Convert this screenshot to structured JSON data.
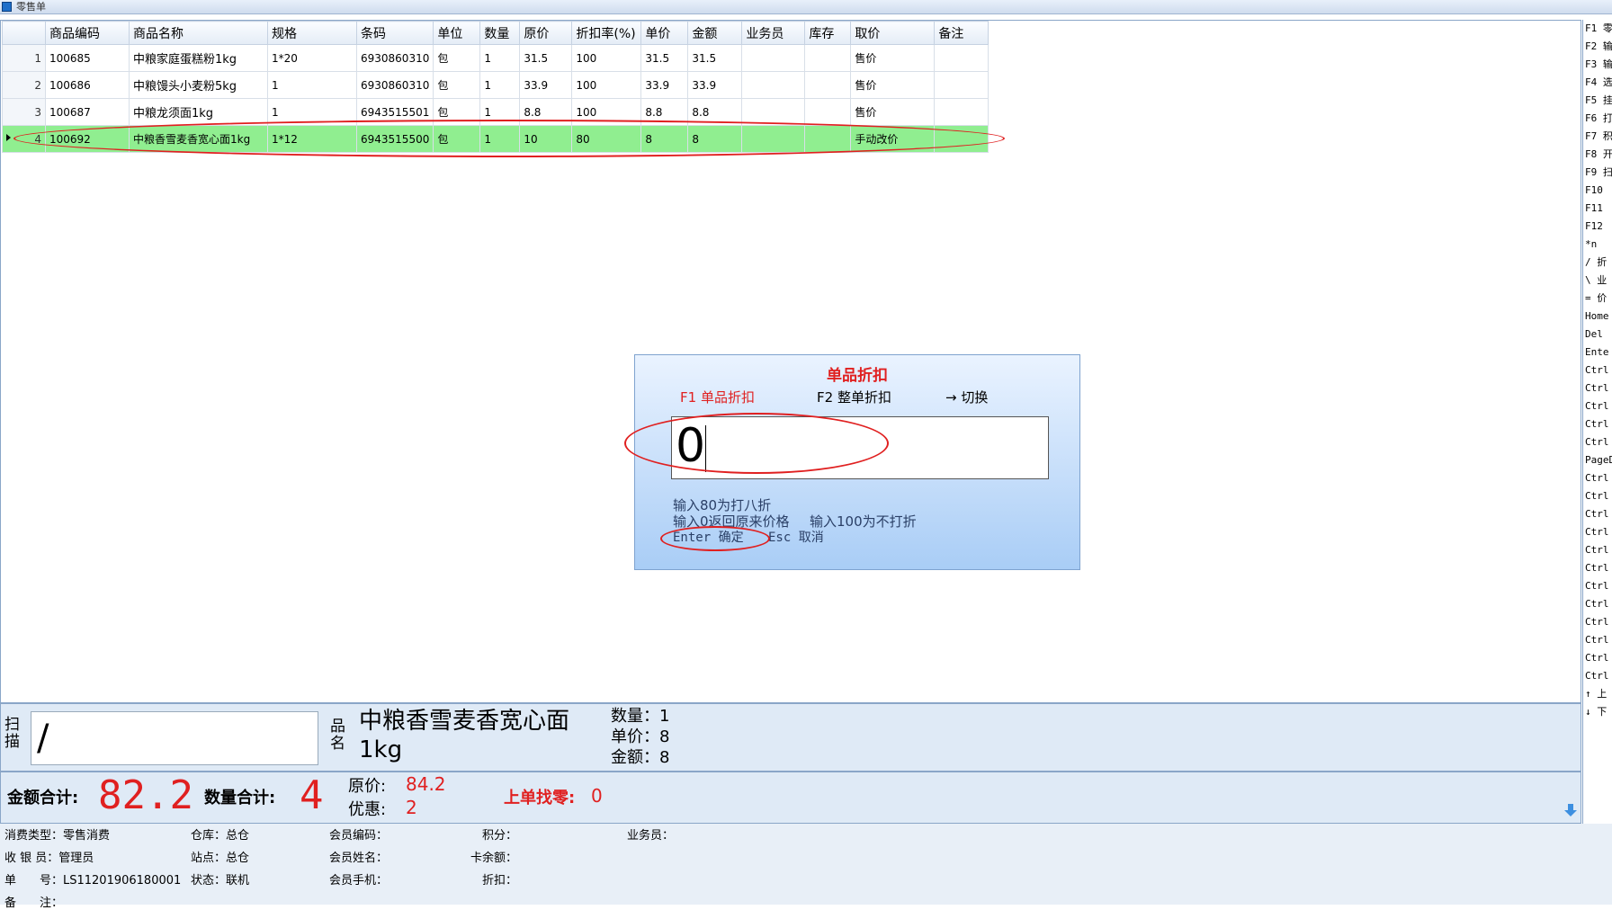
{
  "window": {
    "title": "零售单"
  },
  "grid": {
    "columns": [
      "商品编码",
      "商品名称",
      "规格",
      "条码",
      "单位",
      "数量",
      "原价",
      "折扣率(%)",
      "单价",
      "金额",
      "业务员",
      "库存",
      "取价",
      "备注"
    ],
    "rows": [
      {
        "idx": "1",
        "code": "100685",
        "name": "中粮家庭蛋糕粉1kg",
        "spec": "1*20",
        "barcode": "6930860310",
        "unit": "包",
        "qty": "1",
        "orig": "31.5",
        "rate": "100",
        "price": "31.5",
        "amount": "31.5",
        "sales": "",
        "stock": "",
        "pricing": "售价",
        "note": ""
      },
      {
        "idx": "2",
        "code": "100686",
        "name": "中粮馒头小麦粉5kg",
        "spec": "1",
        "barcode": "6930860310",
        "unit": "包",
        "qty": "1",
        "orig": "33.9",
        "rate": "100",
        "price": "33.9",
        "amount": "33.9",
        "sales": "",
        "stock": "",
        "pricing": "售价",
        "note": ""
      },
      {
        "idx": "3",
        "code": "100687",
        "name": "中粮龙须面1kg",
        "spec": "1",
        "barcode": "6943515501",
        "unit": "包",
        "qty": "1",
        "orig": "8.8",
        "rate": "100",
        "price": "8.8",
        "amount": "8.8",
        "sales": "",
        "stock": "",
        "pricing": "售价",
        "note": ""
      },
      {
        "idx": "4",
        "code": "100692",
        "name": "中粮香雪麦香宽心面1kg",
        "spec": "1*12",
        "barcode": "6943515500",
        "unit": "包",
        "qty": "1",
        "orig": "10",
        "rate": "80",
        "price": "8",
        "amount": "8",
        "sales": "",
        "stock": "",
        "pricing": "手动改价",
        "note": ""
      }
    ]
  },
  "dialog": {
    "title": "单品折扣",
    "tab1": "F1 单品折扣",
    "tab2": "F2 整单折扣",
    "switch": "→ 切换",
    "input_value": "0",
    "hint1": "输入80为打八折",
    "hint2": "输入0返回原来价格",
    "hint3": "输入100为不打折",
    "enter": "Enter 确定",
    "esc": "Esc 取消"
  },
  "scan": {
    "label": "扫描",
    "value": "/",
    "name_label": "品名",
    "product_name": "中粮香雪麦香宽心面",
    "product_name2": "1kg",
    "qty": "数量：1",
    "price": "单价：8",
    "amount": "金额：8"
  },
  "totals": {
    "amount_label": "金额合计:",
    "amount_value": "82.2",
    "qty_label": "数量合计:",
    "qty_value": "4",
    "orig_label": "原价:",
    "orig_value": "84.2",
    "discount_label": "优惠:",
    "discount_value": "2",
    "change_label": "上单找零:",
    "change_value": "0"
  },
  "info": {
    "type": "消费类型：零售消费",
    "warehouse": "仓库：总仓",
    "member_code": "会员编码：",
    "points": "积分：",
    "salesman": "业务员：",
    "cashier": "收 银 员：管理员",
    "site": "站点：总仓",
    "member_name": "会员姓名：",
    "balance": "卡余额：",
    "order_no": "单　　号：LS11201906180001",
    "status": "状态：联机",
    "member_phone": "会员手机：",
    "discount": "折扣：",
    "remark": "备　　注："
  },
  "shortcuts": [
    "F1 零",
    "F2 输",
    "F3 输",
    "F4 选",
    "F5 挂",
    "F6 打",
    "F7 积",
    "F8 开",
    "F9 扫",
    "F10 ",
    "F11 ",
    "F12 ",
    "*n ",
    "/ 折",
    "\\ 业",
    "= 价",
    "Home",
    "Del ",
    "Ente",
    "Ctrl",
    "Ctrl",
    "Ctrl",
    "Ctrl",
    "Ctrl",
    "PageD",
    "Ctrl",
    "Ctrl",
    "Ctrl",
    "Ctrl",
    "Ctrl",
    "Ctrl",
    "Ctrl",
    "Ctrl",
    "Ctrl",
    "Ctrl",
    "Ctrl",
    "Ctrl",
    "↑ 上",
    "↓ 下"
  ]
}
